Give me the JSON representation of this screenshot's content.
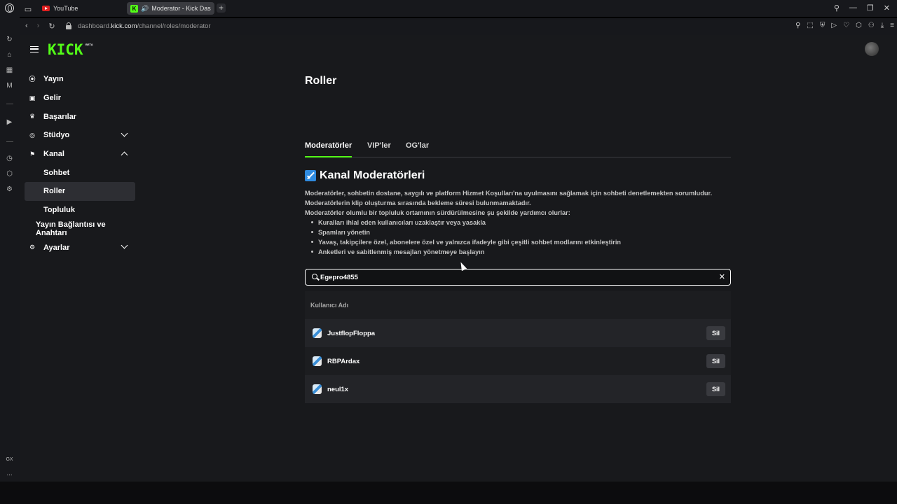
{
  "browser": {
    "tabs": [
      {
        "label": "YouTube"
      },
      {
        "label": "Moderator - Kick Das"
      }
    ],
    "url_prefix": "dashboard.",
    "url_domain": "kick.com",
    "url_path": "/channel/roles/moderator",
    "rail_bottom_label": "GX",
    "rail_more": "..."
  },
  "header": {
    "logo_text": "KICK",
    "beta_label": "BETA"
  },
  "sidebar": {
    "items": [
      {
        "label": "Yayın",
        "icon": "broadcast-icon"
      },
      {
        "label": "Gelir",
        "icon": "wallet-icon"
      },
      {
        "label": "Başarılar",
        "icon": "trophy-icon"
      },
      {
        "label": "Stüdyo",
        "icon": "studio-icon"
      },
      {
        "label": "Kanal",
        "icon": "channel-icon"
      },
      {
        "label": "Sohbet"
      },
      {
        "label": "Roller"
      },
      {
        "label": "Topluluk"
      },
      {
        "label": "Yayın Bağlantısı ve Anahtarı"
      },
      {
        "label": "Ayarlar",
        "icon": "gear-icon"
      }
    ]
  },
  "main": {
    "title": "Roller",
    "tabs": [
      {
        "label": "Moderatörler"
      },
      {
        "label": "VIP'ler"
      },
      {
        "label": "OG'lar"
      }
    ],
    "section_title": "Kanal Moderatörleri",
    "description": [
      "Moderatörler, sohbetin dostane, saygılı ve platform Hizmet Koşulları'na uyulmasını sağlamak için sohbeti denetlemekten sorumludur.",
      "Moderatörlerin klip oluşturma sırasında bekleme süresi bulunmamaktadır.",
      "Moderatörler olumlu bir topluluk ortamının sürdürülmesine şu şekilde yardımcı olurlar:"
    ],
    "bullets": [
      "Kuralları ihlal eden kullanıcıları uzaklaştır veya yasakla",
      "Spamları yönetin",
      "Yavaş, takipçilere özel, abonelere özel ve yalnızca ifadeyle gibi çeşitli sohbet modlarını etkinleştirin",
      "Anketleri ve sabitlenmiş mesajları yönetmeye başlayın"
    ],
    "search": {
      "value": "Egepro4855",
      "clear_icon": "close-icon"
    },
    "table": {
      "header": "Kullanıcı Adı",
      "rows": [
        {
          "username": "JustflopFloppa",
          "action": "Sil"
        },
        {
          "username": "RBPArdax",
          "action": "Sil"
        },
        {
          "username": "neul1x",
          "action": "Sil"
        }
      ]
    }
  },
  "colors": {
    "accent": "#53fc18",
    "background": "#18191c",
    "row_alt": "#232428"
  }
}
